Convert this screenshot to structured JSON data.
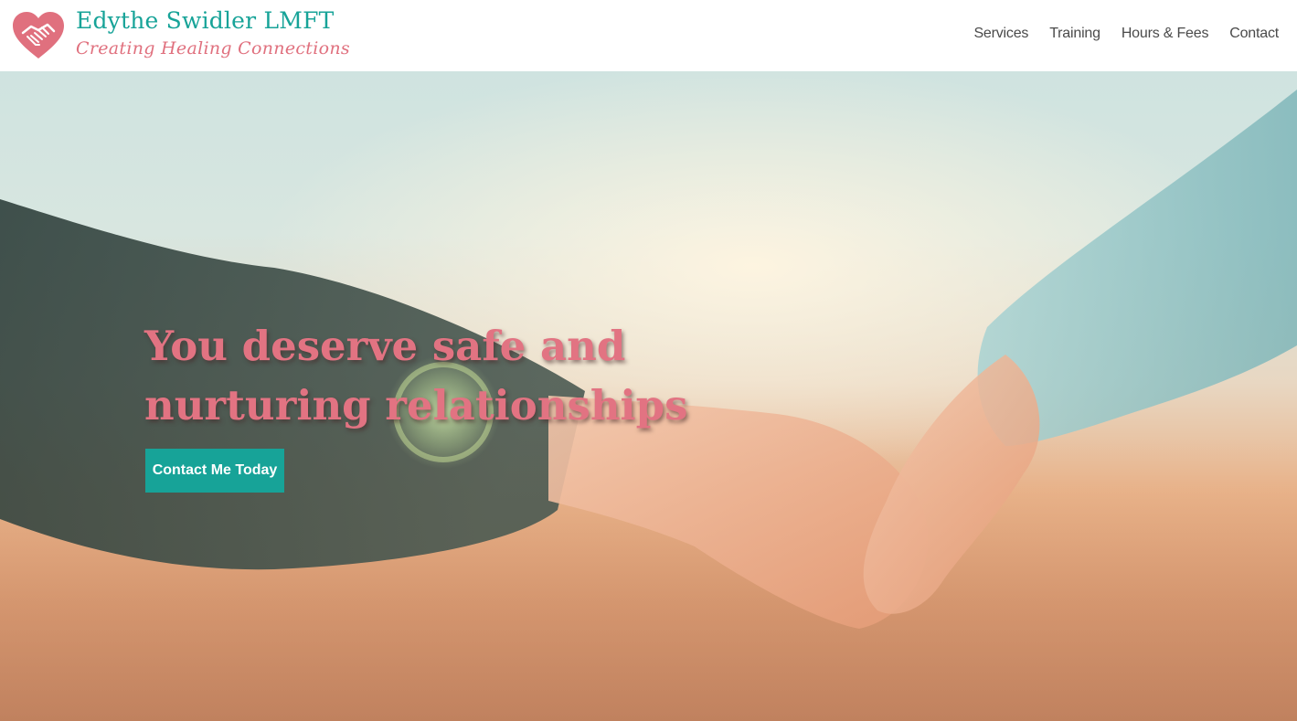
{
  "header": {
    "brand_title": "Edythe Swidler LMFT",
    "brand_tagline": "Creating Healing Connections",
    "logo_icon": "heart-handshake-icon"
  },
  "nav": {
    "items": [
      {
        "label": "Services"
      },
      {
        "label": "Training"
      },
      {
        "label": "Hours & Fees"
      },
      {
        "label": "Contact"
      }
    ]
  },
  "hero": {
    "headline": "You deserve safe and nurturing relationships",
    "cta_label": "Contact Me Today"
  },
  "colors": {
    "brand_teal": "#17a398",
    "brand_pink": "#e0707e",
    "nav_text": "#4a4a4a"
  }
}
